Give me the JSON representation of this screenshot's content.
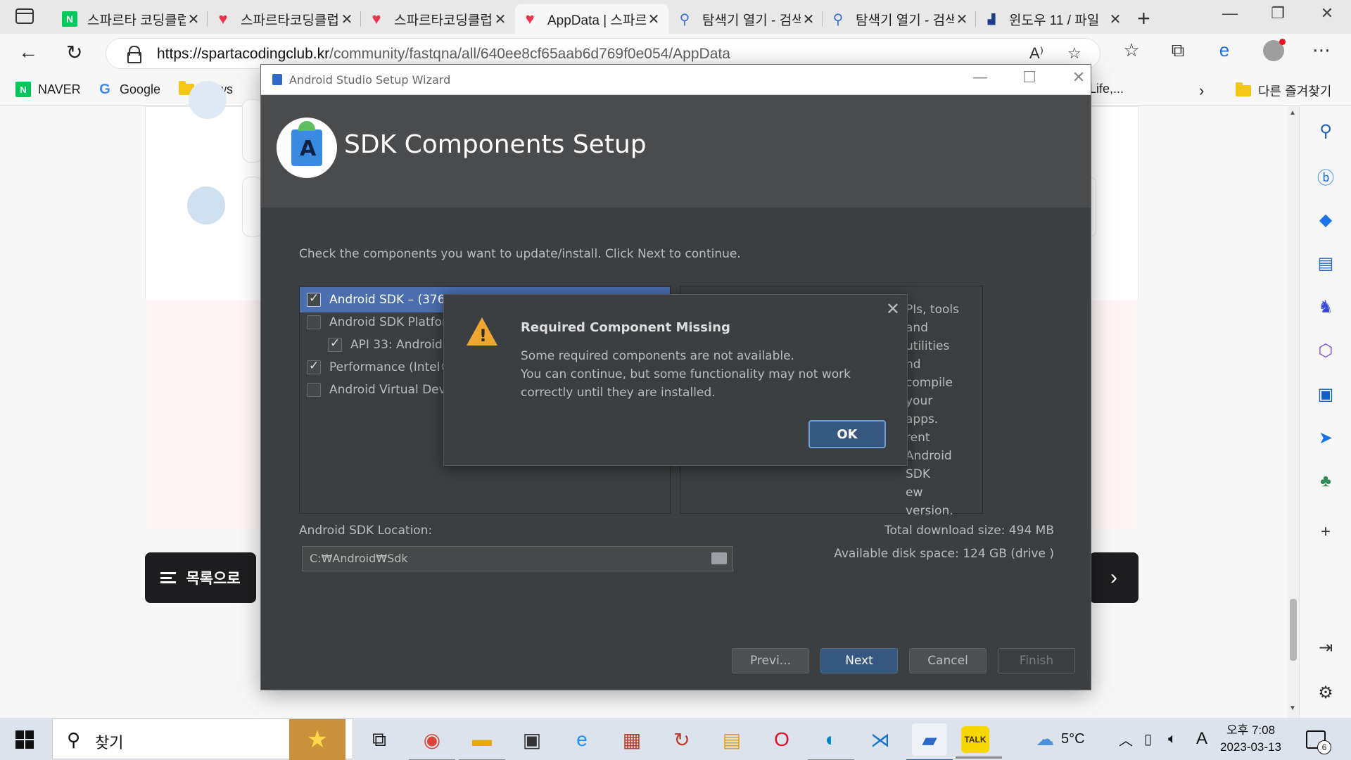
{
  "browser": {
    "tabs": [
      {
        "title": "스파르타 코딩클럽",
        "favicon": "naver-icon"
      },
      {
        "title": "스파르타코딩클럽",
        "favicon": "sparta-icon"
      },
      {
        "title": "스파르타코딩클럽",
        "favicon": "sparta-icon"
      },
      {
        "title": "AppData | 스파르타",
        "favicon": "sparta-icon",
        "active": true
      },
      {
        "title": "탐색기 열기 - 검색",
        "favicon": "search-icon"
      },
      {
        "title": "탐색기 열기 - 검색",
        "favicon": "search-icon"
      },
      {
        "title": "윈도우 11 / 파일",
        "favicon": "windows-icon"
      }
    ],
    "tab_close": "✕",
    "new_tab": "+",
    "url_host": "https://spartacodingclub.kr",
    "url_path": "/community/fastqna/all/640ee8cf65aab6d769f0e054/AppData",
    "favorites": [
      {
        "label": "NAVER",
        "icon": "N"
      },
      {
        "label": "Google",
        "icon": "G"
      },
      {
        "label": "News",
        "icon": "folder"
      }
    ],
    "favorites_right_fragment": "Life,...",
    "other_favorites": "다른 즐겨찾기"
  },
  "page": {
    "list_button": "목록으로",
    "next_button": "›"
  },
  "wizard": {
    "window_title": "Android Studio Setup Wizard",
    "heading": "SDK Components Setup",
    "instruction": "Check the components you want to update/install. Click Next to continue.",
    "components": [
      {
        "label": "Android SDK – (376",
        "checked": true,
        "indent": false,
        "selected": true
      },
      {
        "label": "Android SDK Platfor",
        "checked": false,
        "indent": false,
        "selected": false
      },
      {
        "label": "API 33: Android",
        "checked": true,
        "indent": true,
        "selected": false
      },
      {
        "label": "Performance (Intel®",
        "checked": true,
        "indent": false,
        "selected": false
      },
      {
        "label": "Android Virtual Devi",
        "checked": false,
        "indent": false,
        "selected": false
      }
    ],
    "description_lines": [
      "PIs, tools and utilities",
      "nd compile your apps.",
      "rent Android SDK",
      "ew version."
    ],
    "sdk_location_label": "Android SDK Location:",
    "sdk_location_value": "C:₩Android₩Sdk",
    "total_download": "Total download size: 494 MB",
    "disk_space": "Available disk space: 124 GB (drive )",
    "buttons": {
      "previous": "Previ...",
      "next": "Next",
      "cancel": "Cancel",
      "finish": "Finish"
    }
  },
  "dialog": {
    "title": "Required Component Missing",
    "line1": "Some required components are not available.",
    "line2": "You can continue, but some functionality may not work",
    "line3": "correctly until they are installed.",
    "ok": "OK"
  },
  "taskbar": {
    "search_placeholder": "찾기",
    "weather": "5°C",
    "ime": "A",
    "time": "오후 7:08",
    "date": "2023-03-13",
    "notification_count": "6"
  },
  "colors": {
    "wizard_bg": "#3c3f41",
    "selection": "#4b6eaf",
    "primary_button": "#365880",
    "warning": "#f0a732"
  }
}
